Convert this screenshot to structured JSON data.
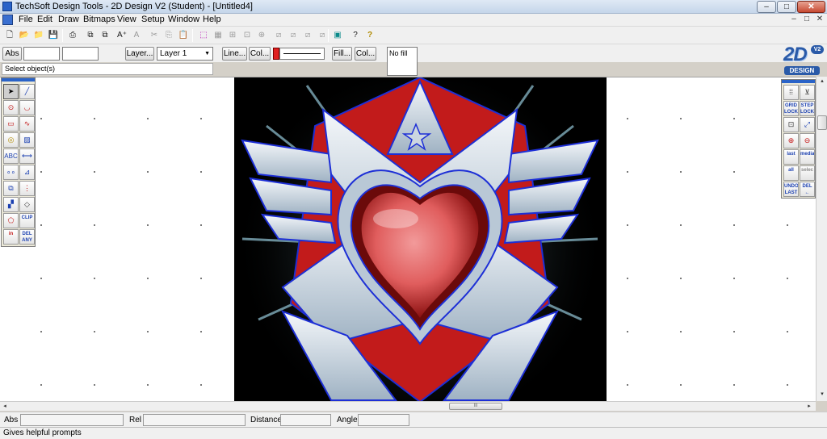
{
  "window": {
    "title": "TechSoft Design Tools - 2D Design V2 (Student) - [Untitled4]",
    "minimize": "–",
    "maximize": "□",
    "close": "✕"
  },
  "menu": {
    "items": [
      "File",
      "Edit",
      "Draw",
      "Bitmaps",
      "View",
      "Setup",
      "Window",
      "Help"
    ],
    "mdi_min": "–",
    "mdi_restore": "□",
    "mdi_close": "✕"
  },
  "toolbar": {
    "new": "🗋",
    "open": "📂",
    "open2": "📁",
    "save": "💾",
    "print": "⎙",
    "copy_view": "⧉",
    "paste_view": "⧉",
    "text_a": "A⁺",
    "text_style": "A",
    "cut": "✂",
    "copy": "⎘",
    "paste": "📋",
    "select": "⬚",
    "t1": "▦",
    "t2": "⊞",
    "t3": "⊡",
    "t4": "⊕",
    "t5": "⧄",
    "t6": "⧄",
    "t7": "⧄",
    "t8": "⧄",
    "t9": "⧄",
    "screen": "▣",
    "help_what": "?",
    "help": "?"
  },
  "props": {
    "abs": "Abs",
    "layer_btn": "Layer...",
    "layer_value": "Layer 1",
    "line_btn": "Line...",
    "col_btn": "Col...",
    "fill_btn": "Fill...",
    "fill_col_btn": "Col...",
    "fill_value": "No fill",
    "line_color": "#e02020"
  },
  "hint": "Select object(s)",
  "logo": {
    "main": "2D",
    "version": "V2",
    "design": "DESIGN"
  },
  "left_tools": [
    {
      "name": "pointer",
      "label": "➤"
    },
    {
      "name": "line",
      "label": "╱"
    },
    {
      "name": "circle",
      "label": "⊙"
    },
    {
      "name": "arc",
      "label": "◡"
    },
    {
      "name": "rectangle",
      "label": "▭"
    },
    {
      "name": "curve",
      "label": "∿"
    },
    {
      "name": "offset",
      "label": "◎"
    },
    {
      "name": "hatch",
      "label": "▨"
    },
    {
      "name": "text",
      "label": "ABC"
    },
    {
      "name": "dimension",
      "label": "⟷"
    },
    {
      "name": "points",
      "label": "∘∘"
    },
    {
      "name": "trim",
      "label": "⊿"
    },
    {
      "name": "group",
      "label": "⧉"
    },
    {
      "name": "array",
      "label": "⋮"
    },
    {
      "name": "transform",
      "label": "▞"
    },
    {
      "name": "erase",
      "label": "◇"
    },
    {
      "name": "polygon",
      "label": "⬠"
    },
    {
      "name": "clip",
      "label": "CLIP"
    },
    {
      "name": "in",
      "label": "in"
    },
    {
      "name": "del-any",
      "label": "DEL ANY"
    }
  ],
  "right_tools": [
    {
      "name": "grid",
      "label": "⁞⁞"
    },
    {
      "name": "pin",
      "label": "⊻"
    },
    {
      "name": "grid-lock",
      "label": "GRID LOCK"
    },
    {
      "name": "step-lock",
      "label": "STEP LOCK"
    },
    {
      "name": "snap-center",
      "label": "⊡"
    },
    {
      "name": "snap-line",
      "label": "⤢"
    },
    {
      "name": "zoom-in",
      "label": "⊕"
    },
    {
      "name": "zoom-out",
      "label": "⊖"
    },
    {
      "name": "last",
      "label": "last"
    },
    {
      "name": "media",
      "label": "media"
    },
    {
      "name": "all",
      "label": "all"
    },
    {
      "name": "select",
      "label": "selec"
    },
    {
      "name": "undo-last",
      "label": "UNDO LAST"
    },
    {
      "name": "del",
      "label": "DEL ←"
    }
  ],
  "coords": {
    "abs": "Abs",
    "rel": "Rel",
    "distance": "Distance",
    "angle": "Angle"
  },
  "hscroll": {
    "left": "◂",
    "right": "▸",
    "grip": "III"
  },
  "vscroll": {
    "up": "▴",
    "down": "▾"
  },
  "status": "Gives helpful prompts"
}
